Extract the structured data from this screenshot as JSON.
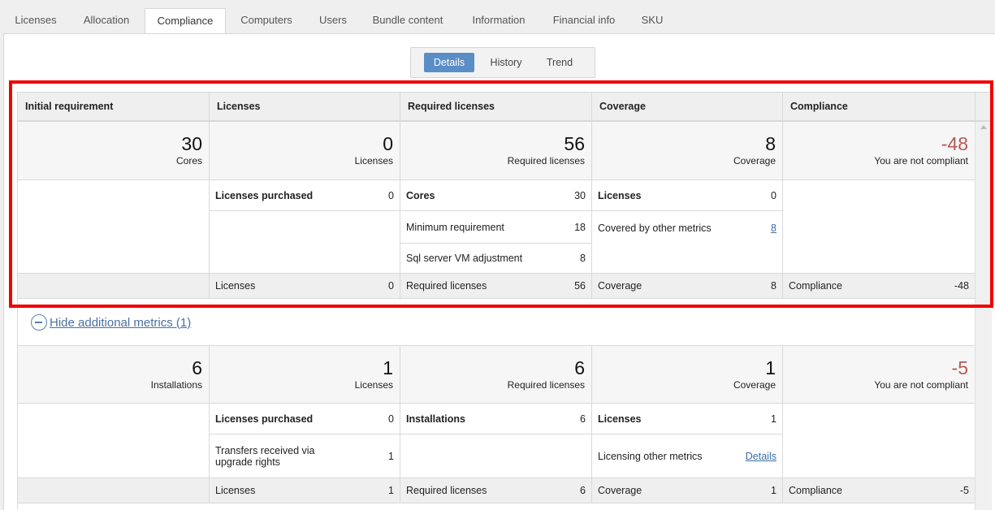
{
  "tabs": [
    {
      "label": "Licenses",
      "active": false
    },
    {
      "label": "Allocation",
      "active": false
    },
    {
      "label": "Compliance",
      "active": true
    },
    {
      "label": "Computers",
      "active": false
    },
    {
      "label": "Users",
      "active": false
    },
    {
      "label": "Bundle content",
      "active": false
    },
    {
      "label": "Information",
      "active": false
    },
    {
      "label": "Financial info",
      "active": false
    },
    {
      "label": "SKU",
      "active": false
    }
  ],
  "subtabs": [
    {
      "label": "Details",
      "active": true
    },
    {
      "label": "History",
      "active": false
    },
    {
      "label": "Trend",
      "active": false
    }
  ],
  "columns": [
    "Initial requirement",
    "Licenses",
    "Required licenses",
    "Coverage",
    "Compliance"
  ],
  "primary": {
    "summary": [
      {
        "value": "30",
        "caption": "Cores"
      },
      {
        "value": "0",
        "caption": "Licenses"
      },
      {
        "value": "56",
        "caption": "Required licenses"
      },
      {
        "value": "8",
        "caption": "Coverage"
      },
      {
        "value": "-48",
        "caption": "You are not compliant"
      }
    ],
    "licenses_rows": [
      {
        "label": "Licenses purchased",
        "value": "0"
      }
    ],
    "required_rows": [
      {
        "label": "Cores",
        "value": "30"
      },
      {
        "label": "Minimum requirement",
        "value": "18"
      },
      {
        "label": "Sql server VM adjustment",
        "value": "8"
      }
    ],
    "coverage_rows": [
      {
        "label": "Licenses",
        "value": "0"
      },
      {
        "label": "Covered by other metrics",
        "value": "8"
      }
    ],
    "totals": [
      {
        "label": "Licenses",
        "value": "0"
      },
      {
        "label": "Required licenses",
        "value": "56"
      },
      {
        "label": "Coverage",
        "value": "8"
      },
      {
        "label": "Compliance",
        "value": "-48"
      }
    ]
  },
  "toggle_label": "Hide additional metrics (1)",
  "secondary": {
    "summary": [
      {
        "value": "6",
        "caption": "Installations"
      },
      {
        "value": "1",
        "caption": "Licenses"
      },
      {
        "value": "6",
        "caption": "Required licenses"
      },
      {
        "value": "1",
        "caption": "Coverage"
      },
      {
        "value": "-5",
        "caption": "You are not compliant"
      }
    ],
    "licenses_rows": [
      {
        "label": "Licenses purchased",
        "value": "0"
      },
      {
        "label": "Transfers received via upgrade rights",
        "value": "1"
      }
    ],
    "required_rows": [
      {
        "label": "Installations",
        "value": "6"
      }
    ],
    "coverage_rows": [
      {
        "label": "Licenses",
        "value": "1"
      },
      {
        "label": "Licensing other metrics",
        "value": "Details"
      }
    ],
    "totals": [
      {
        "label": "Licenses",
        "value": "1"
      },
      {
        "label": "Required licenses",
        "value": "6"
      },
      {
        "label": "Coverage",
        "value": "1"
      },
      {
        "label": "Compliance",
        "value": "-5"
      }
    ]
  },
  "colors": {
    "accent": "#5a8ec6",
    "negative": "#b55a55",
    "link": "#3a6ea5",
    "highlight": "#f20000"
  }
}
